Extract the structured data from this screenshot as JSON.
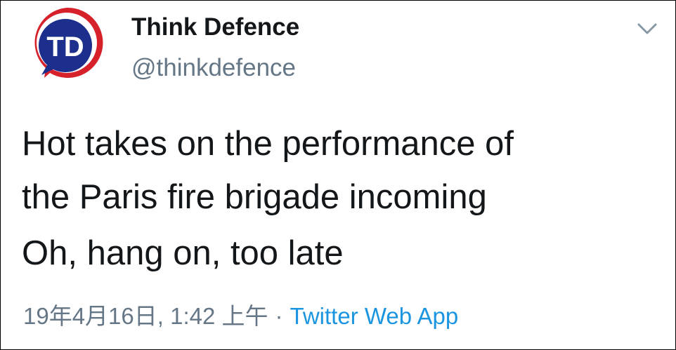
{
  "tweet": {
    "author": {
      "display_name": "Think Defence",
      "handle": "@thinkdefence",
      "avatar_text": "TD"
    },
    "menu_icon": "chevron-down-icon",
    "text_lines": [
      "Hot takes on the performance of",
      "the Paris fire brigade incoming",
      "Oh, hang on, too late"
    ],
    "timestamp": "19年4月16日, 1:42 上午",
    "separator": "·",
    "source": "Twitter Web App"
  },
  "colors": {
    "text": "#14171a",
    "secondary": "#657786",
    "link": "#1b95e0",
    "avatar_ring": "#d6202a",
    "avatar_fill": "#1d2f8c"
  }
}
